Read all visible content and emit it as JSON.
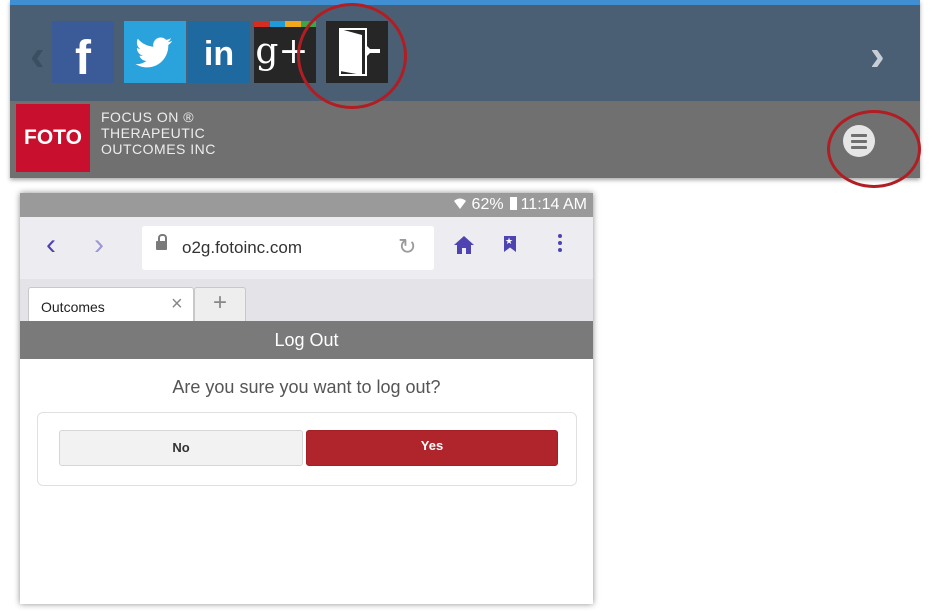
{
  "social_bar": {
    "facebook_glyph": "f",
    "linkedin_glyph": "in",
    "googleplus_glyph": "g+",
    "arrow_left": "‹",
    "arrow_right": "›"
  },
  "logo_bar": {
    "logo_text": "FOTO",
    "company_lines": [
      "FOCUS ON ®",
      "THERAPEUTIC",
      "OUTCOMES INC"
    ]
  },
  "status_bar": {
    "battery": "62%",
    "time": "11:14 AM"
  },
  "browser": {
    "back": "‹",
    "forward": "›",
    "url": "o2g.fotoinc.com",
    "reload": "↻",
    "tabs": [
      {
        "label": "Outcomes",
        "close": "×"
      }
    ],
    "new_tab": "+"
  },
  "page": {
    "header": "Log Out",
    "question": "Are you sure you want to log out?",
    "no_label": "No",
    "yes_label": "Yes"
  },
  "colors": {
    "accent_blue": "#3f8fd2",
    "social_bar": "#4b5f74",
    "logo_red": "#c8102e",
    "yes_red": "#b0242b",
    "highlight_circle": "#b01e24",
    "browser_purple": "#4d44b2"
  }
}
